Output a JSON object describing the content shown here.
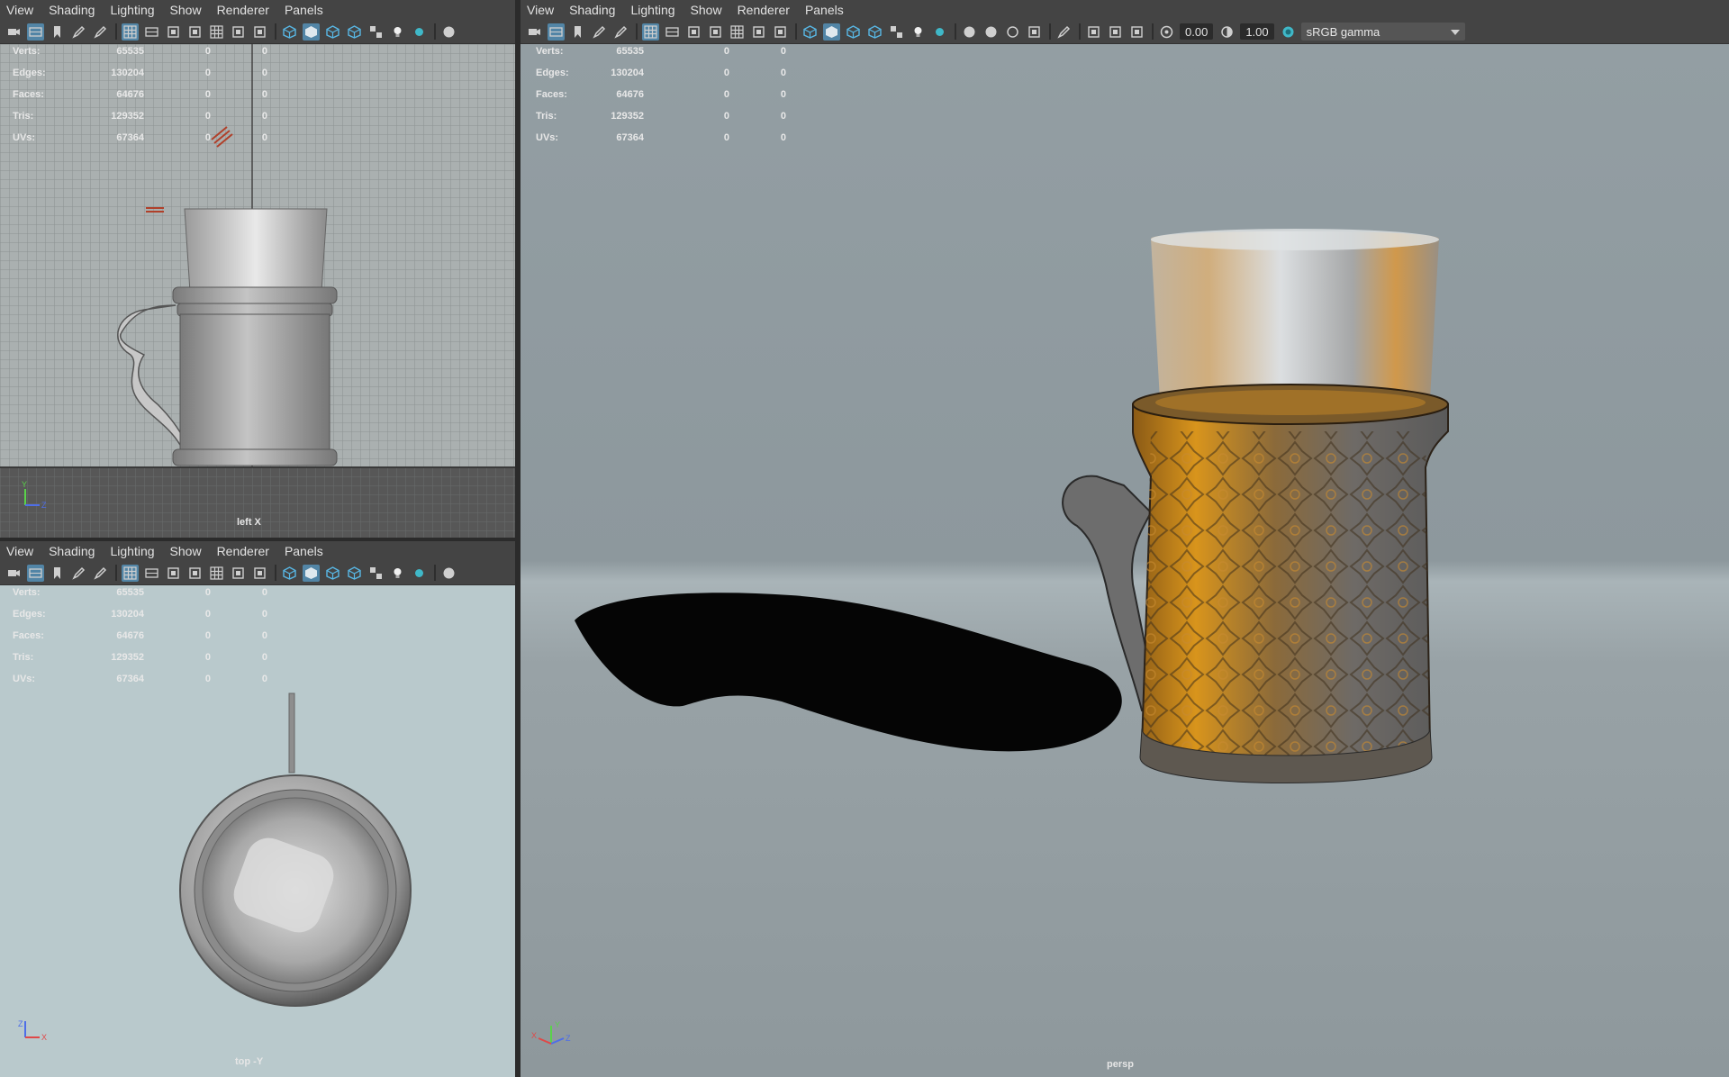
{
  "menus": [
    "View",
    "Shading",
    "Lighting",
    "Show",
    "Renderer",
    "Panels"
  ],
  "hud": {
    "rows": [
      {
        "label": "Verts:",
        "count": "65535",
        "a": "0",
        "b": "0"
      },
      {
        "label": "Edges:",
        "count": "130204",
        "a": "0",
        "b": "0"
      },
      {
        "label": "Faces:",
        "count": "64676",
        "a": "0",
        "b": "0"
      },
      {
        "label": "Tris:",
        "count": "129352",
        "a": "0",
        "b": "0"
      },
      {
        "label": "UVs:",
        "count": "67364",
        "a": "0",
        "b": "0"
      }
    ]
  },
  "viewports": {
    "left": {
      "camera": "left X"
    },
    "top": {
      "camera": "top -Y"
    },
    "persp": {
      "camera": "persp"
    }
  },
  "persp_toolbar": {
    "exposure": "0.00",
    "gamma": "1.00",
    "color_space": "sRGB gamma"
  },
  "colors": {
    "accent": "#5285a6",
    "ui_background": "#444444",
    "left_grid_bg": "#aab0b0",
    "top_view_bg": "#b9c9cc",
    "persp_bg": "#8e999e"
  },
  "icons": {
    "axis": "axis-gizmo-icon"
  }
}
